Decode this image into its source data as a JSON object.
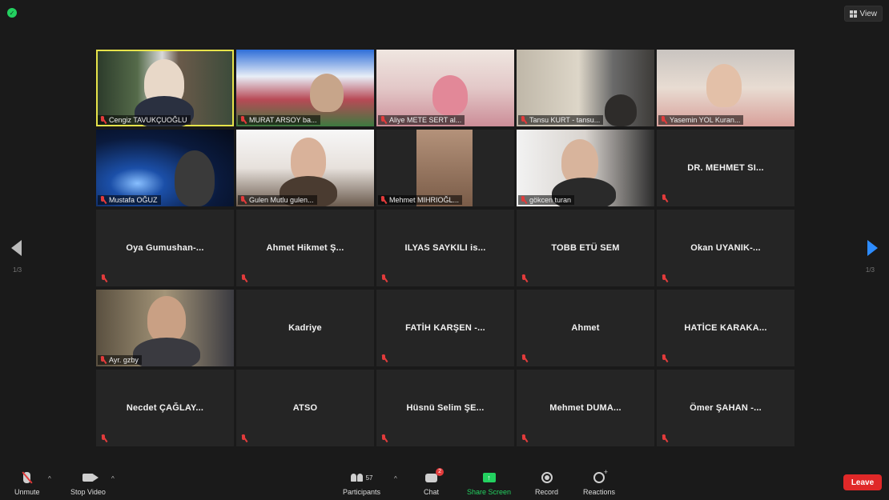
{
  "header": {
    "view_label": "View"
  },
  "colors": {
    "speaking_border": "#e6e34a",
    "mic_muted": "#e23b3b",
    "share_green": "#23d160",
    "leave_red": "#e02828",
    "nav_blue": "#2d8cff"
  },
  "grid": {
    "tiles": [
      {
        "label": "Cengiz TAVUKÇUOĞLU",
        "center": "",
        "video": true
      },
      {
        "label": "MURAT ARSOY ba...",
        "center": "",
        "video": true
      },
      {
        "label": "Aliye METE SERT al...",
        "center": "",
        "video": true
      },
      {
        "label": "Tansu KURT - tansu...",
        "center": "",
        "video": true
      },
      {
        "label": "Yasemin YOL Kuran...",
        "center": "",
        "video": true
      },
      {
        "label": "Mustafa OĞUZ",
        "center": "",
        "video": true
      },
      {
        "label": "Gulen Mutlu gulen...",
        "center": "",
        "video": true
      },
      {
        "label": "Mehmet MIHRIOĞL...",
        "center": "",
        "video": true
      },
      {
        "label": "gökcen turan",
        "center": "",
        "video": true
      },
      {
        "label": "",
        "center": "DR. MEHMET SI...",
        "video": false
      },
      {
        "label": "",
        "center": "Oya Gumushan-...",
        "video": false
      },
      {
        "label": "",
        "center": "Ahmet Hikmet Ş...",
        "video": false
      },
      {
        "label": "",
        "center": "ILYAS SAYKILI is...",
        "video": false
      },
      {
        "label": "",
        "center": "TOBB ETÜ SEM",
        "video": false
      },
      {
        "label": "",
        "center": "Okan UYANIK-...",
        "video": false
      },
      {
        "label": "Ayr. gzby",
        "center": "",
        "video": true
      },
      {
        "label": "",
        "center": "Kadriye",
        "video": false
      },
      {
        "label": "",
        "center": "FATİH KARŞEN -...",
        "video": false
      },
      {
        "label": "",
        "center": "Ahmet",
        "video": false
      },
      {
        "label": "",
        "center": "HATİCE KARAKA...",
        "video": false
      },
      {
        "label": "",
        "center": "Necdet ÇAĞLAY...",
        "video": false
      },
      {
        "label": "",
        "center": "ATSO",
        "video": false
      },
      {
        "label": "",
        "center": "Hüsnü Selim ŞE...",
        "video": false
      },
      {
        "label": "",
        "center": "Mehmet DUMA...",
        "video": false
      },
      {
        "label": "",
        "center": "Ömer ŞAHAN -...",
        "video": false
      }
    ]
  },
  "pager": {
    "left": "1/3",
    "right": "1/3"
  },
  "toolbar": {
    "unmute": "Unmute",
    "stop_video": "Stop Video",
    "participants": "Participants",
    "participant_count": "57",
    "chat": "Chat",
    "chat_badge": "2",
    "share_screen": "Share Screen",
    "record": "Record",
    "reactions": "Reactions",
    "leave": "Leave"
  }
}
